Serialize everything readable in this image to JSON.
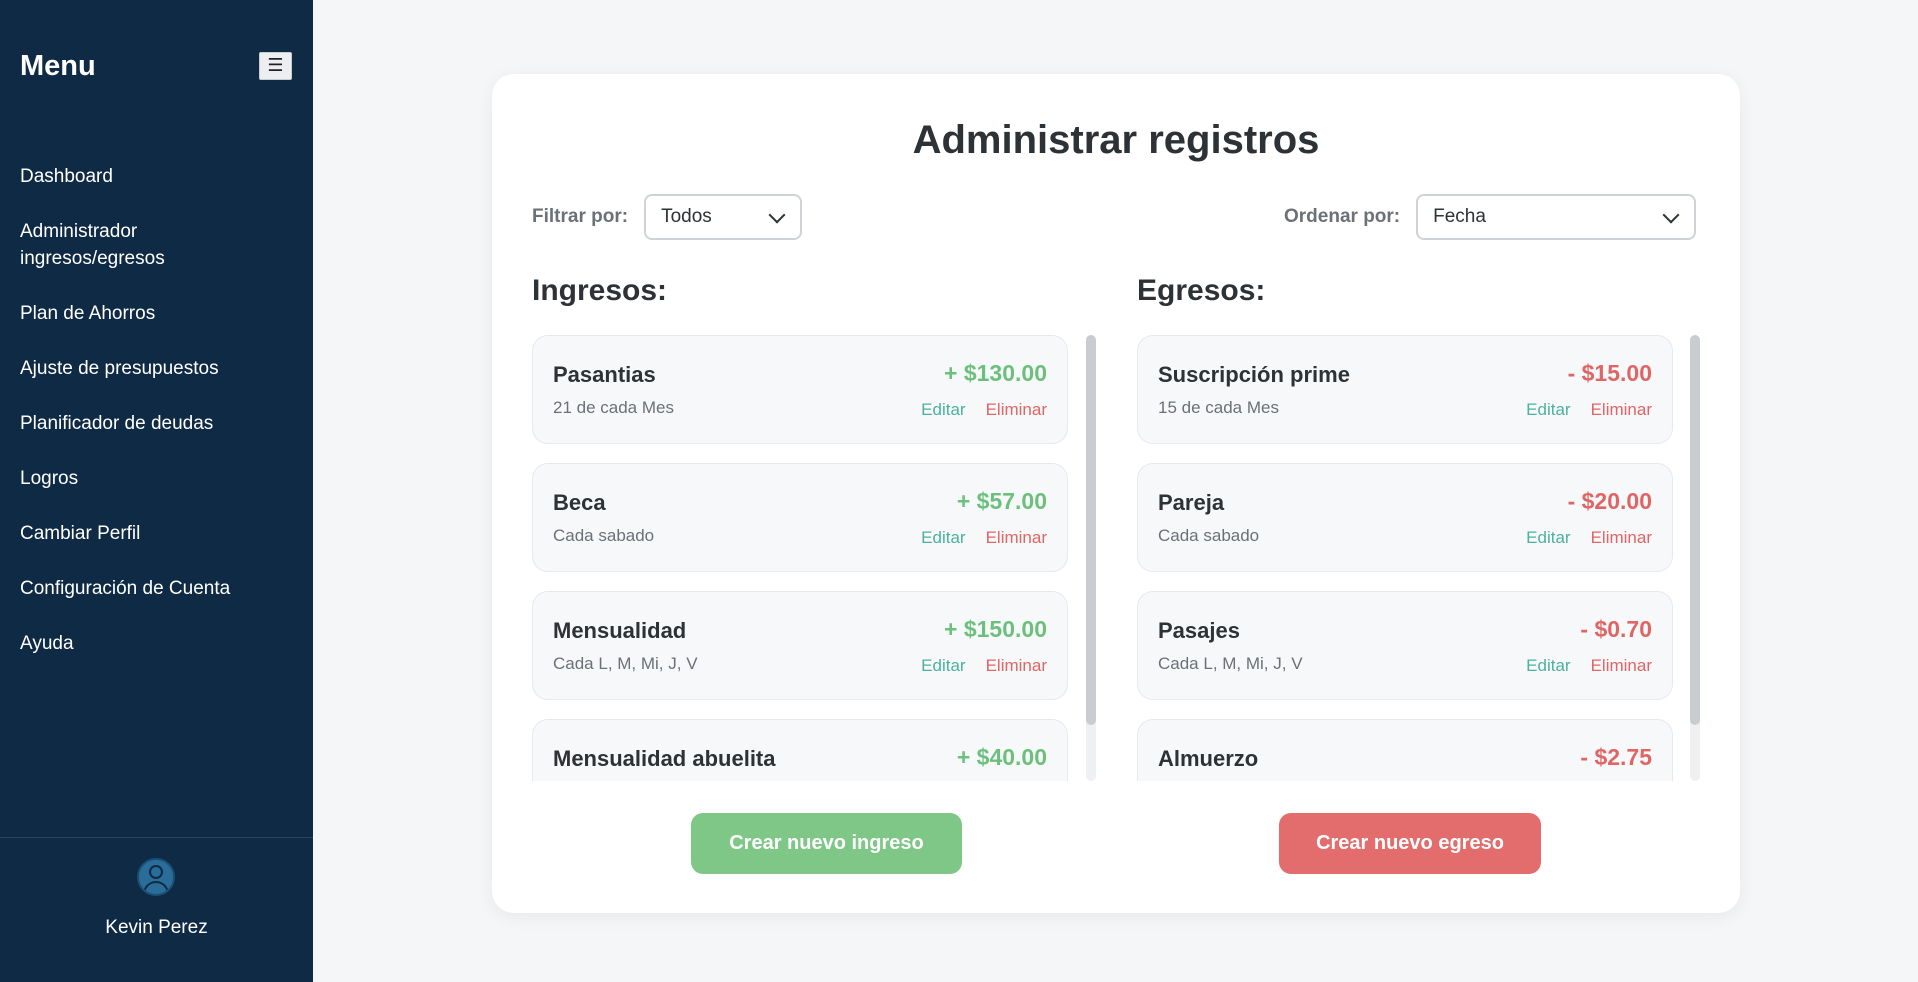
{
  "sidebar": {
    "title": "Menu",
    "toggle_icon": "☰",
    "items": [
      {
        "label": "Dashboard"
      },
      {
        "label": "Administrador ingresos/egresos"
      },
      {
        "label": "Plan de Ahorros"
      },
      {
        "label": "Ajuste de presupuestos"
      },
      {
        "label": "Planificador de deudas"
      },
      {
        "label": "Logros"
      },
      {
        "label": "Cambiar Perfil"
      },
      {
        "label": "Configuración de Cuenta"
      },
      {
        "label": "Ayuda"
      }
    ],
    "user": {
      "name": "Kevin Perez",
      "avatar_icon": "user-avatar-icon"
    }
  },
  "main": {
    "title": "Administrar registros",
    "filter": {
      "label": "Filtrar por:",
      "value": "Todos"
    },
    "sort": {
      "label": "Ordenar por:",
      "value": "Fecha"
    },
    "ingresos": {
      "title": "Ingresos:",
      "items": [
        {
          "name": "Pasantias",
          "frequency": "21 de cada Mes",
          "amount": "+ $130.00",
          "edit": "Editar",
          "delete": "Eliminar"
        },
        {
          "name": "Beca",
          "frequency": "Cada sabado",
          "amount": "+ $57.00",
          "edit": "Editar",
          "delete": "Eliminar"
        },
        {
          "name": "Mensualidad",
          "frequency": "Cada L, M, Mi, J, V",
          "amount": "+ $150.00",
          "edit": "Editar",
          "delete": "Eliminar"
        },
        {
          "name": "Mensualidad abuelita",
          "frequency": "",
          "amount": "+ $40.00",
          "edit": "",
          "delete": ""
        }
      ],
      "create_button": "Crear nuevo ingreso"
    },
    "egresos": {
      "title": "Egresos:",
      "items": [
        {
          "name": "Suscripción prime",
          "frequency": "15 de cada Mes",
          "amount": "- $15.00",
          "edit": "Editar",
          "delete": "Eliminar"
        },
        {
          "name": "Pareja",
          "frequency": "Cada sabado",
          "amount": "- $20.00",
          "edit": "Editar",
          "delete": "Eliminar"
        },
        {
          "name": "Pasajes",
          "frequency": "Cada L, M, Mi, J, V",
          "amount": "- $0.70",
          "edit": "Editar",
          "delete": "Eliminar"
        },
        {
          "name": "Almuerzo",
          "frequency": "",
          "amount": "- $2.75",
          "edit": "",
          "delete": ""
        }
      ],
      "create_button": "Crear nuevo egreso"
    }
  },
  "colors": {
    "sidebar_bg": "#0f2a44",
    "income_green": "#7ec787",
    "expense_red": "#e36d6d",
    "edit_teal": "#4bb1a0"
  }
}
